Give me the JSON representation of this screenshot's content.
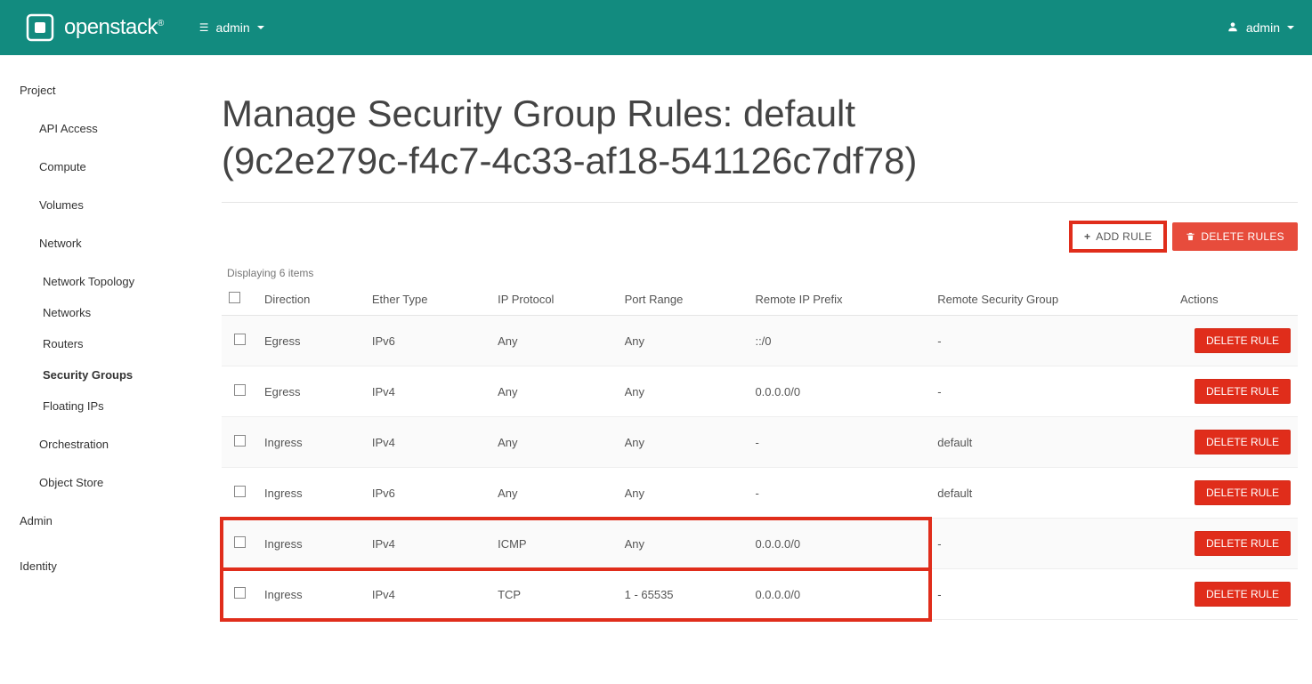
{
  "brand": {
    "name": "openstack",
    "tm": "®"
  },
  "topbar": {
    "project_selector": "admin",
    "user": "admin"
  },
  "sidebar": {
    "project": "Project",
    "api_access": "API Access",
    "compute": "Compute",
    "volumes": "Volumes",
    "network": "Network",
    "network_topology": "Network Topology",
    "networks": "Networks",
    "routers": "Routers",
    "security_groups": "Security Groups",
    "floating_ips": "Floating IPs",
    "orchestration": "Orchestration",
    "object_store": "Object Store",
    "admin": "Admin",
    "identity": "Identity"
  },
  "page": {
    "title": "Manage Security Group Rules: default (9c2e279c-f4c7-4c33-af18-541126c7df78)",
    "add_rule": "Add Rule",
    "delete_rules": "Delete Rules",
    "displaying": "Displaying 6 items"
  },
  "columns": {
    "direction": "Direction",
    "ether_type": "Ether Type",
    "ip_protocol": "IP Protocol",
    "port_range": "Port Range",
    "remote_ip": "Remote IP Prefix",
    "remote_sg": "Remote Security Group",
    "actions": "Actions"
  },
  "actions": {
    "delete_rule": "Delete Rule"
  },
  "rows": [
    {
      "direction": "Egress",
      "ether_type": "IPv6",
      "ip_protocol": "Any",
      "port_range": "Any",
      "remote_ip": "::/0",
      "remote_sg": "-"
    },
    {
      "direction": "Egress",
      "ether_type": "IPv4",
      "ip_protocol": "Any",
      "port_range": "Any",
      "remote_ip": "0.0.0.0/0",
      "remote_sg": "-"
    },
    {
      "direction": "Ingress",
      "ether_type": "IPv4",
      "ip_protocol": "Any",
      "port_range": "Any",
      "remote_ip": "-",
      "remote_sg": "default"
    },
    {
      "direction": "Ingress",
      "ether_type": "IPv6",
      "ip_protocol": "Any",
      "port_range": "Any",
      "remote_ip": "-",
      "remote_sg": "default"
    },
    {
      "direction": "Ingress",
      "ether_type": "IPv4",
      "ip_protocol": "ICMP",
      "port_range": "Any",
      "remote_ip": "0.0.0.0/0",
      "remote_sg": "-"
    },
    {
      "direction": "Ingress",
      "ether_type": "IPv4",
      "ip_protocol": "TCP",
      "port_range": "1 - 65535",
      "remote_ip": "0.0.0.0/0",
      "remote_sg": "-"
    }
  ]
}
